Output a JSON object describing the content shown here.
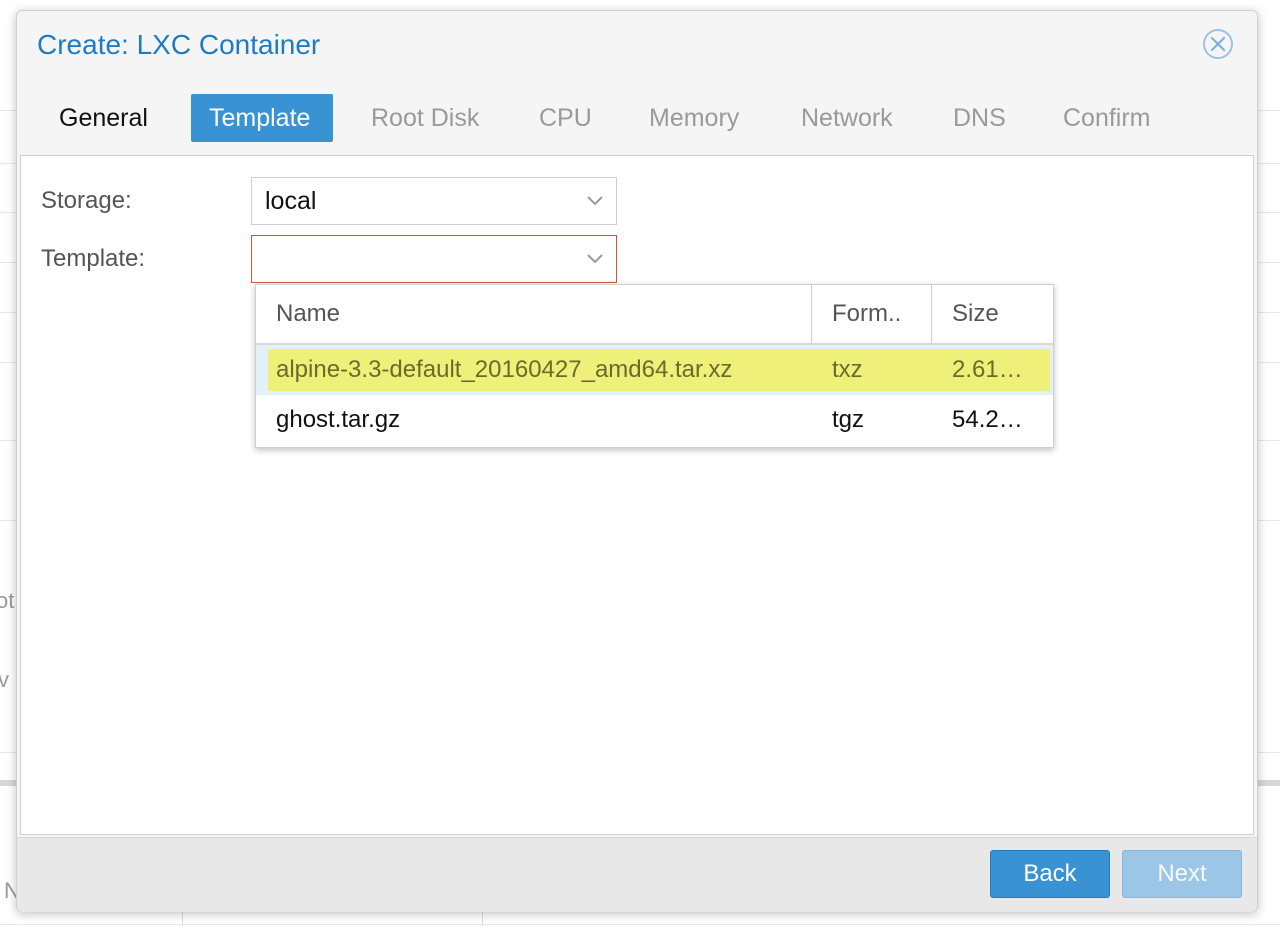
{
  "background": {
    "fragments": [
      "ot",
      "v",
      "N"
    ]
  },
  "dialog": {
    "title": "Create: LXC Container",
    "close_icon": "close-circle-icon"
  },
  "tabs": [
    {
      "label": "General",
      "state": "enabled"
    },
    {
      "label": "Template",
      "state": "active"
    },
    {
      "label": "Root Disk",
      "state": "disabled"
    },
    {
      "label": "CPU",
      "state": "disabled"
    },
    {
      "label": "Memory",
      "state": "disabled"
    },
    {
      "label": "Network",
      "state": "disabled"
    },
    {
      "label": "DNS",
      "state": "disabled"
    },
    {
      "label": "Confirm",
      "state": "disabled"
    }
  ],
  "form": {
    "storage_label": "Storage:",
    "storage_value": "local",
    "template_label": "Template:",
    "template_value": "",
    "trigger_icon": "chevron-down-icon",
    "invalid_color": "#d0553b"
  },
  "picker": {
    "columns": [
      "Name",
      "Form..",
      "Size"
    ],
    "rows": [
      {
        "name": "alpine-3.3-default_20160427_amd64.tar.xz",
        "format": "txz",
        "size": "2.61…",
        "highlighted": true
      },
      {
        "name": "ghost.tar.gz",
        "format": "tgz",
        "size": "54.2…",
        "highlighted": false
      }
    ],
    "highlight_color": "#eef07a"
  },
  "footer": {
    "back_label": "Back",
    "next_label": "Next"
  },
  "colors": {
    "accent": "#3892d4",
    "title": "#1d7cc4"
  }
}
